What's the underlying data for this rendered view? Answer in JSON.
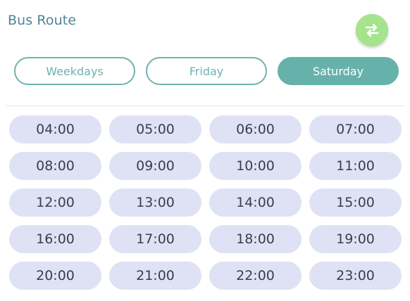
{
  "header": {
    "title": "Bus Route",
    "swap_icon": "swap-arrows-icon"
  },
  "colors": {
    "title": "#4e8594",
    "swap_button": "#a5e38c",
    "tab_accent": "#66b2ab",
    "time_chip": "#dfe2f5"
  },
  "tabs": [
    {
      "label": "Weekdays",
      "active": false
    },
    {
      "label": "Friday",
      "active": false
    },
    {
      "label": "Saturday",
      "active": true
    }
  ],
  "times": [
    "04:00",
    "05:00",
    "06:00",
    "07:00",
    "08:00",
    "09:00",
    "10:00",
    "11:00",
    "12:00",
    "13:00",
    "14:00",
    "15:00",
    "16:00",
    "17:00",
    "18:00",
    "19:00",
    "20:00",
    "21:00",
    "22:00",
    "23:00"
  ]
}
